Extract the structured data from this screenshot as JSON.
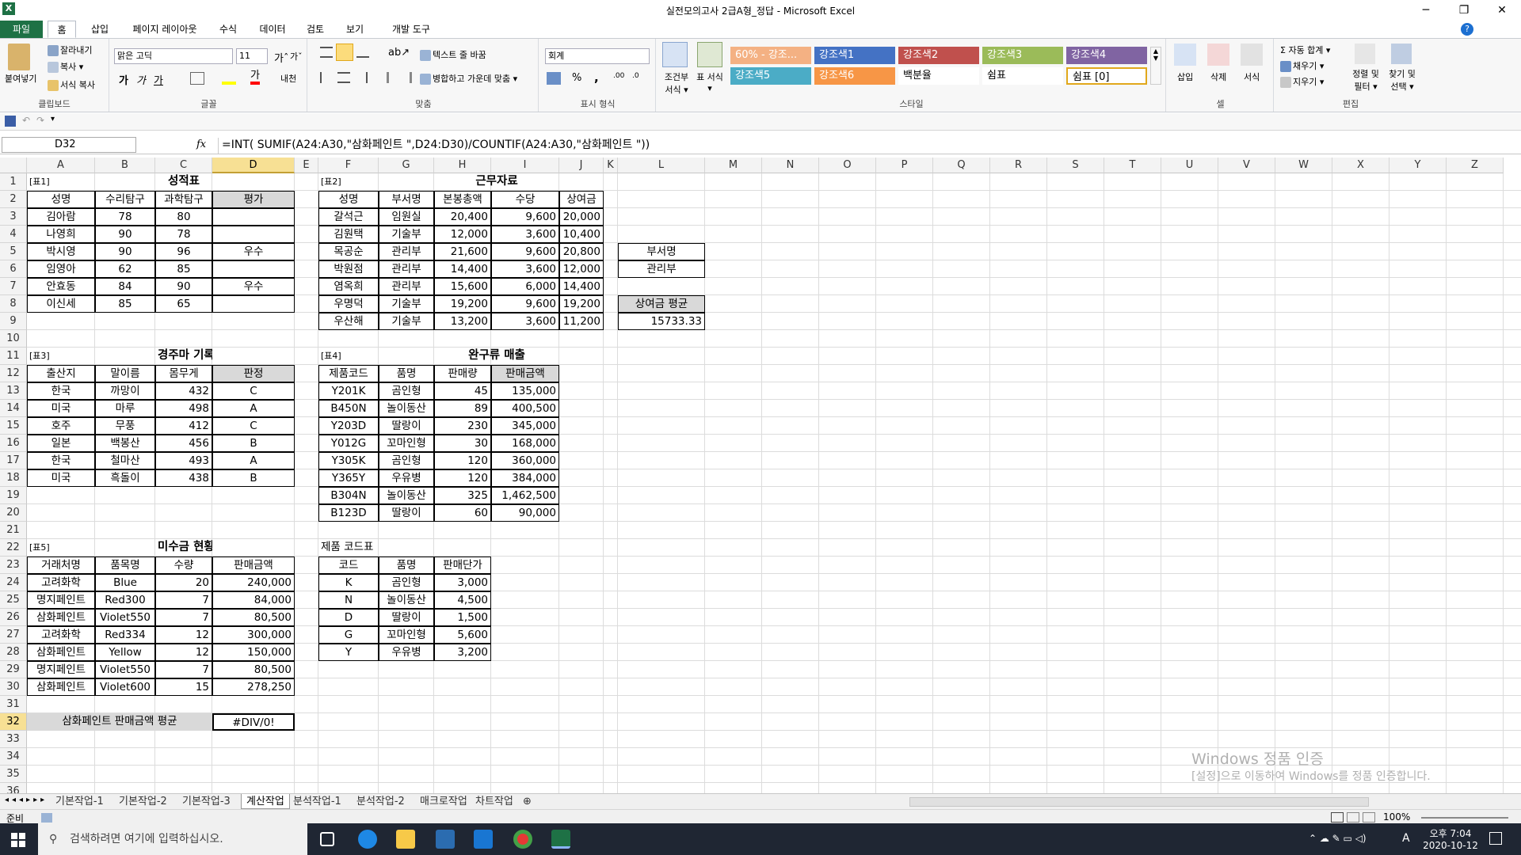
{
  "window": {
    "title": "실전모의고사 2급A형_정답  -  Microsoft Excel",
    "app_icon": "X"
  },
  "ribbon_tabs": [
    "파일",
    "홈",
    "삽입",
    "페이지 레이아웃",
    "수식",
    "데이터",
    "검토",
    "보기",
    "개발 도구"
  ],
  "ribbon": {
    "clipboard": {
      "label": "클립보드",
      "paste": "붙여넣기",
      "cut": "잘라내기",
      "copy": "복사 ▾",
      "format_painter": "서식 복사"
    },
    "font": {
      "label": "글꼴",
      "font_name": "맑은 고딕",
      "font_size": "11",
      "bold": "가",
      "italic": "가",
      "underline": "가",
      "grow": "가ˆ",
      "shrink": "가ˇ",
      "phonetic": "내천",
      "font_color": "가"
    },
    "align": {
      "label": "맞춤",
      "wrap": "텍스트 줄 바꿈",
      "merge": "병합하고 가운데 맞춤 ▾"
    },
    "number": {
      "label": "표시 형식",
      "format": "회계",
      "percent": "%",
      "comma": ","
    },
    "styles": {
      "label": "스타일",
      "cond_format": "조건부 서식 ▾",
      "table_format": "표 서식 ▾",
      "cells": [
        {
          "text": "60% - 강조...",
          "color": "#f4b183"
        },
        {
          "text": "강조색1",
          "color": "#4472c4"
        },
        {
          "text": "강조색2",
          "color": "#c0504d"
        },
        {
          "text": "강조색3",
          "color": "#9bbb59"
        },
        {
          "text": "강조색4",
          "color": "#8064a2"
        },
        {
          "text": "강조색5",
          "color": "#4bacc6"
        },
        {
          "text": "강조색6",
          "color": "#f79646"
        },
        {
          "text": "백분율",
          "color": "#ffffff"
        },
        {
          "text": "쉼표",
          "color": "#ffffff"
        },
        {
          "text": "쉼표 [0]",
          "color": "#ffffff"
        }
      ]
    },
    "cells_group": {
      "label": "셀",
      "insert": "삽입",
      "delete": "삭제",
      "format": "서식"
    },
    "editing": {
      "label": "편집",
      "autosum": "Σ 자동 합계 ▾",
      "fill": "채우기 ▾",
      "clear": "지우기 ▾",
      "sort": "정렬 및 필터 ▾",
      "find": "찾기 및 선택 ▾"
    }
  },
  "formula_bar": {
    "name_box": "D32",
    "fx": "fx",
    "formula": "=INT( SUMIF(A24:A30,\"삼화페인트 \",D24:D30)/COUNTIF(A24:A30,\"삼화페인트 \"))"
  },
  "columns": [
    "A",
    "B",
    "C",
    "D",
    "E",
    "F",
    "G",
    "H",
    "I",
    "J",
    "K",
    "L",
    "M",
    "N",
    "O",
    "P",
    "Q",
    "R",
    "S",
    "T",
    "U",
    "V",
    "W",
    "X",
    "Y",
    "Z"
  ],
  "rows": [
    "1",
    "2",
    "3",
    "4",
    "5",
    "6",
    "7",
    "8",
    "9",
    "10",
    "11",
    "12",
    "13",
    "14",
    "15",
    "16",
    "17",
    "18",
    "19",
    "20",
    "21",
    "22",
    "23",
    "24",
    "25",
    "26",
    "27",
    "28",
    "29",
    "30",
    "31",
    "32",
    "33",
    "34",
    "35",
    "36"
  ],
  "tables": {
    "t1": {
      "tag": "[표1]",
      "title": "성적표",
      "headers": [
        "성명",
        "수리탐구",
        "과학탐구",
        "평가"
      ],
      "rows": [
        [
          "김아람",
          "78",
          "80",
          ""
        ],
        [
          "나영희",
          "90",
          "78",
          ""
        ],
        [
          "박시영",
          "90",
          "96",
          "우수"
        ],
        [
          "임영아",
          "62",
          "85",
          ""
        ],
        [
          "안효동",
          "84",
          "90",
          "우수"
        ],
        [
          "이신세",
          "85",
          "65",
          ""
        ]
      ]
    },
    "t2": {
      "tag": "[표2]",
      "title": "근무자료",
      "headers": [
        "성명",
        "부서명",
        "본봉총액",
        "수당",
        "상여금"
      ],
      "rows": [
        [
          "갈석근",
          "임원실",
          "20,400",
          "9,600",
          "20,000"
        ],
        [
          "김원택",
          "기술부",
          "12,000",
          "3,600",
          "10,400"
        ],
        [
          "목공순",
          "관리부",
          "21,600",
          "9,600",
          "20,800"
        ],
        [
          "박원점",
          "관리부",
          "14,400",
          "3,600",
          "12,000"
        ],
        [
          "염옥희",
          "관리부",
          "15,600",
          "6,000",
          "14,400"
        ],
        [
          "우명덕",
          "기술부",
          "19,200",
          "9,600",
          "19,200"
        ],
        [
          "우산해",
          "기술부",
          "13,200",
          "3,600",
          "11,200"
        ]
      ],
      "criteria_header": "부서명",
      "criteria_value": "관리부",
      "avg_label": "상여금 평균",
      "avg_value": "15733.33"
    },
    "t3": {
      "tag": "[표3]",
      "title": "경주마 기록",
      "headers": [
        "출산지",
        "말이름",
        "몸무게",
        "판정"
      ],
      "rows": [
        [
          "한국",
          "까망이",
          "432",
          "C"
        ],
        [
          "미국",
          "마루",
          "498",
          "A"
        ],
        [
          "호주",
          "무풍",
          "412",
          "C"
        ],
        [
          "일본",
          "백봉산",
          "456",
          "B"
        ],
        [
          "한국",
          "철마산",
          "493",
          "A"
        ],
        [
          "미국",
          "흑돌이",
          "438",
          "B"
        ]
      ]
    },
    "t4": {
      "tag": "[표4]",
      "title": "완구류 매출",
      "headers": [
        "제품코드",
        "품명",
        "판매량",
        "판매금액"
      ],
      "rows": [
        [
          "Y201K",
          "곰인형",
          "45",
          "135,000"
        ],
        [
          "B450N",
          "놀이동산",
          "89",
          "400,500"
        ],
        [
          "Y203D",
          "딸랑이",
          "230",
          "345,000"
        ],
        [
          "Y012G",
          "꼬마인형",
          "30",
          "168,000"
        ],
        [
          "Y305K",
          "곰인형",
          "120",
          "360,000"
        ],
        [
          "Y365Y",
          "우유병",
          "120",
          "384,000"
        ],
        [
          "B304N",
          "놀이동산",
          "325",
          "1,462,500"
        ],
        [
          "B123D",
          "딸랑이",
          "60",
          "90,000"
        ]
      ]
    },
    "t5": {
      "tag": "[표5]",
      "title": "미수금 현황",
      "headers": [
        "거래처명",
        "품목명",
        "수량",
        "판매금액"
      ],
      "rows": [
        [
          "고려화학",
          "Blue",
          "20",
          "240,000"
        ],
        [
          "명지페인트",
          "Red300",
          "7",
          "84,000"
        ],
        [
          "삼화페인트",
          "Violet550",
          "7",
          "80,500"
        ],
        [
          "고려화학",
          "Red334",
          "12",
          "300,000"
        ],
        [
          "삼화페인트",
          "Yellow",
          "12",
          "150,000"
        ],
        [
          "명지페인트",
          "Violet550",
          "7",
          "80,500"
        ],
        [
          "삼화페인트",
          "Violet600",
          "15",
          "278,250"
        ]
      ],
      "avg_label": "삼화페인트 판매금액 평균",
      "avg_value": "#DIV/0!"
    },
    "t6": {
      "title": "제품 코드표",
      "headers": [
        "코드",
        "품명",
        "판매단가"
      ],
      "rows": [
        [
          "K",
          "곰인형",
          "3,000"
        ],
        [
          "N",
          "놀이동산",
          "4,500"
        ],
        [
          "D",
          "딸랑이",
          "1,500"
        ],
        [
          "G",
          "꼬마인형",
          "5,600"
        ],
        [
          "Y",
          "우유병",
          "3,200"
        ]
      ]
    }
  },
  "sheet_tabs": [
    "기본작업-1",
    "기본작업-2",
    "기본작업-3",
    "계산작업",
    "분석작업-1",
    "분석작업-2",
    "매크로작업",
    "차트작업"
  ],
  "active_sheet": "계산작업",
  "status": {
    "mode": "준비",
    "zoom": "100%"
  },
  "watermark": {
    "line1": "Windows 정품 인증",
    "line2": "[설정]으로 이동하여 Windows를 정품 인증합니다."
  },
  "taskbar": {
    "search_placeholder": "검색하려면 여기에 입력하십시오.",
    "time": "오후 7:04",
    "date": "2020-10-12",
    "ime": "A"
  }
}
